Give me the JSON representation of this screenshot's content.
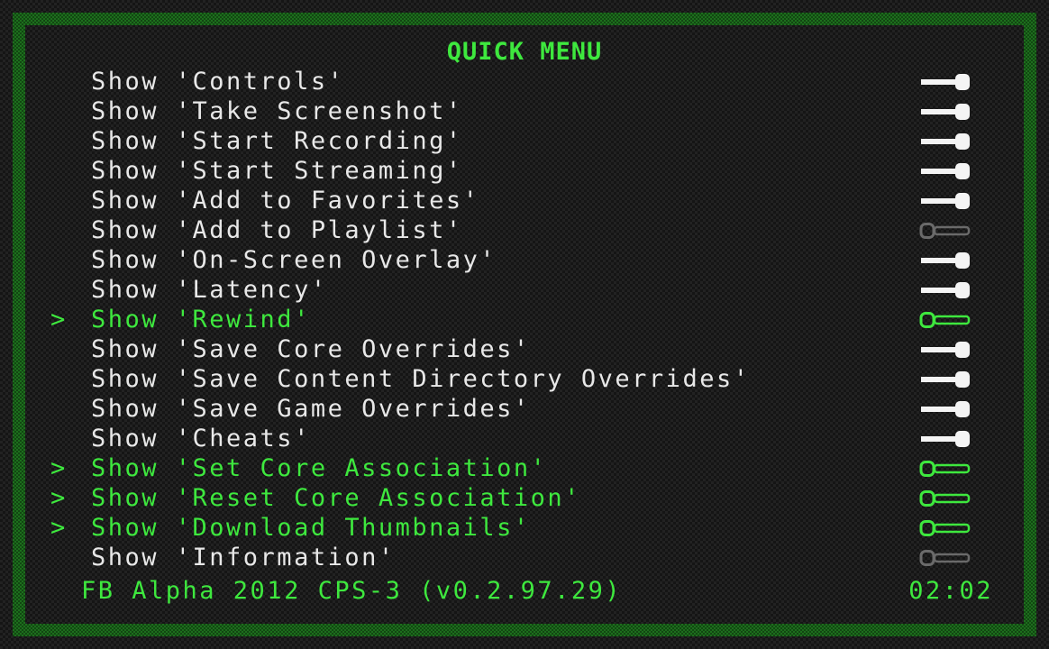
{
  "menu": {
    "title": "QUICK MENU",
    "items": [
      {
        "label": "Show 'Controls'",
        "state": "on",
        "selected": false
      },
      {
        "label": "Show 'Take Screenshot'",
        "state": "on",
        "selected": false
      },
      {
        "label": "Show 'Start Recording'",
        "state": "on",
        "selected": false
      },
      {
        "label": "Show 'Start Streaming'",
        "state": "on",
        "selected": false
      },
      {
        "label": "Show 'Add to Favorites'",
        "state": "on",
        "selected": false
      },
      {
        "label": "Show 'Add to Playlist'",
        "state": "off",
        "selected": false
      },
      {
        "label": "Show 'On-Screen Overlay'",
        "state": "on",
        "selected": false
      },
      {
        "label": "Show 'Latency'",
        "state": "on",
        "selected": false
      },
      {
        "label": "Show 'Rewind'",
        "state": "off",
        "selected": true
      },
      {
        "label": "Show 'Save Core Overrides'",
        "state": "on",
        "selected": false
      },
      {
        "label": "Show 'Save Content Directory Overrides'",
        "state": "on",
        "selected": false
      },
      {
        "label": "Show 'Save Game Overrides'",
        "state": "on",
        "selected": false
      },
      {
        "label": "Show 'Cheats'",
        "state": "on",
        "selected": false
      },
      {
        "label": "Show 'Set Core Association'",
        "state": "off",
        "selected": true
      },
      {
        "label": "Show 'Reset Core Association'",
        "state": "off",
        "selected": true
      },
      {
        "label": "Show 'Download Thumbnails'",
        "state": "off",
        "selected": true
      },
      {
        "label": "Show 'Information'",
        "state": "off",
        "selected": false
      }
    ]
  },
  "selection_marker": ">",
  "footer": {
    "core": "FB Alpha 2012 CPS-3 (v0.2.97.29)",
    "clock": "02:02"
  },
  "colors": {
    "accent": "#3ee83e",
    "border": "#1d6e1d",
    "text": "#e8e8e8",
    "toggle_off": "#6a6a6a"
  },
  "icons": {
    "toggle_on": "toggle-on-icon",
    "toggle_off": "toggle-off-icon"
  }
}
